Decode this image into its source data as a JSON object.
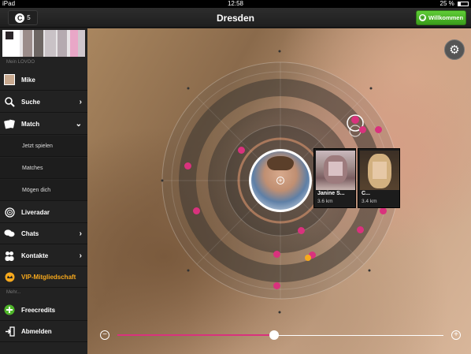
{
  "status_bar": {
    "device": "iPad",
    "time": "12:58",
    "battery": "25 %",
    "battery_level": 0.25
  },
  "topbar": {
    "title": "Dresden",
    "credits_count": "5",
    "credits_icon": "credits-c-icon",
    "welcome_label": "Willkommen",
    "welcome_color": "#4fb52a"
  },
  "sidebar": {
    "section_label": "Mein LOVOO",
    "user_name": "Mike",
    "items": [
      {
        "label": "Suche",
        "icon": "search-icon",
        "chevron": "›"
      },
      {
        "label": "Match",
        "icon": "cards-icon",
        "chevron": "⌄"
      },
      {
        "label": "Liveradar",
        "icon": "radar-icon"
      },
      {
        "label": "Chats",
        "icon": "chat-icon",
        "chevron": "›"
      },
      {
        "label": "Kontakte",
        "icon": "contacts-icon",
        "chevron": "›"
      },
      {
        "label": "VIP-Mitgliedschaft",
        "icon": "vip-icon"
      }
    ],
    "match_sub": [
      "Jetzt spielen",
      "Matches",
      "Mögen dich"
    ],
    "more_label": "Mehr...",
    "bottom": [
      {
        "label": "Freecredits",
        "icon": "plus-icon"
      },
      {
        "label": "Abmelden",
        "icon": "logout-icon"
      }
    ]
  },
  "radar": {
    "cards": [
      {
        "name": "Janine S...",
        "distance": "3.6 km"
      },
      {
        "name": "C...",
        "distance": "3.4 km"
      }
    ]
  },
  "slider": {
    "value": 0.48,
    "minus": "−",
    "plus": "+"
  },
  "colors": {
    "accent": "#d9327d",
    "vip": "#f7a91d",
    "green": "#4fb52a"
  }
}
